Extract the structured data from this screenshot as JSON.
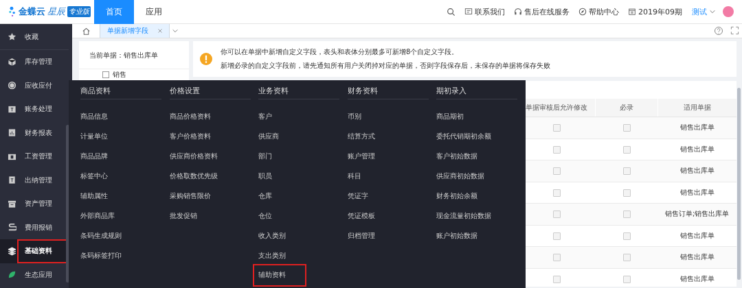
{
  "topbar": {
    "logo": {
      "brand": "金蝶云",
      "product": "星辰",
      "edition": "专业版"
    },
    "nav": [
      {
        "label": "首页",
        "selected": true
      },
      {
        "label": "应用",
        "selected": false
      }
    ],
    "links": [
      {
        "kind": "chat",
        "label": "联系我们"
      },
      {
        "kind": "headset",
        "label": "售后在线服务"
      },
      {
        "kind": "compass",
        "label": "帮助中心"
      },
      {
        "kind": "calendar",
        "label": "2019年09期"
      }
    ],
    "user": "测试"
  },
  "sidebar": {
    "items": [
      {
        "label": "收藏",
        "selected": false,
        "highlighted": false
      },
      {
        "label": "库存管理",
        "selected": false,
        "highlighted": false
      },
      {
        "label": "应收应付",
        "selected": false,
        "highlighted": false
      },
      {
        "label": "账务处理",
        "selected": false,
        "highlighted": false
      },
      {
        "label": "财务报表",
        "selected": false,
        "highlighted": false
      },
      {
        "label": "工资管理",
        "selected": false,
        "highlighted": false
      },
      {
        "label": "出纳管理",
        "selected": false,
        "highlighted": false
      },
      {
        "label": "资产管理",
        "selected": false,
        "highlighted": false
      },
      {
        "label": "费用报销",
        "selected": false,
        "highlighted": false
      },
      {
        "label": "基础资料",
        "selected": true,
        "highlighted": true
      },
      {
        "label": "生态应用",
        "selected": false,
        "highlighted": false
      }
    ]
  },
  "tabs": [
    {
      "label": "单据新增字段",
      "selected": true
    }
  ],
  "current_doc": {
    "label": "当前单据：销售出库单",
    "tree_item": "销售"
  },
  "notice": [
    "你可以在单据中新增自定义字段，表头和表体分别最多可新增8个自定义字段。",
    "新增必录的自定义字段前，请先通知所有用户关闭掉对应的单据，否则字段保存后，未保存的单据将保存失败"
  ],
  "table": {
    "columns": [
      "单据审核后允许修改",
      "必录",
      "适用单据"
    ],
    "rows": [
      {
        "allow_edit": false,
        "required": false,
        "doc": "销售出库单"
      },
      {
        "allow_edit": false,
        "required": false,
        "doc": "销售出库单"
      },
      {
        "allow_edit": false,
        "required": false,
        "doc": "销售出库单"
      },
      {
        "allow_edit": false,
        "required": false,
        "doc": "销售出库单"
      },
      {
        "allow_edit": false,
        "required": false,
        "doc": "销售订单;销售出库单"
      },
      {
        "allow_edit": false,
        "required": false,
        "doc": "销售出库单"
      },
      {
        "allow_edit": false,
        "required": false,
        "doc": "销售出库单"
      },
      {
        "allow_edit": false,
        "required": false,
        "doc": "销售出库单"
      }
    ]
  },
  "menu": {
    "columns": [
      {
        "title": "商品资料",
        "items": [
          {
            "label": "商品信息",
            "highlighted": false
          },
          {
            "label": "计量单位",
            "highlighted": false
          },
          {
            "label": "商品品牌",
            "highlighted": false
          },
          {
            "label": "标签中心",
            "highlighted": false
          },
          {
            "label": "辅助属性",
            "highlighted": false
          },
          {
            "label": "外部商品库",
            "highlighted": false
          },
          {
            "label": "条码生成规则",
            "highlighted": false
          },
          {
            "label": "条码标签打印",
            "highlighted": false
          }
        ]
      },
      {
        "title": "价格设置",
        "items": [
          {
            "label": "商品价格资料",
            "highlighted": false
          },
          {
            "label": "客户价格资料",
            "highlighted": false
          },
          {
            "label": "供应商价格资料",
            "highlighted": false
          },
          {
            "label": "价格取数优先级",
            "highlighted": false
          },
          {
            "label": "采购销售限价",
            "highlighted": false
          },
          {
            "label": "批发促销",
            "highlighted": false
          }
        ]
      },
      {
        "title": "业务资料",
        "items": [
          {
            "label": "客户",
            "highlighted": false
          },
          {
            "label": "供应商",
            "highlighted": false
          },
          {
            "label": "部门",
            "highlighted": false
          },
          {
            "label": "职员",
            "highlighted": false
          },
          {
            "label": "仓库",
            "highlighted": false
          },
          {
            "label": "仓位",
            "highlighted": false
          },
          {
            "label": "收入类别",
            "highlighted": false
          },
          {
            "label": "支出类别",
            "highlighted": false
          },
          {
            "label": "辅助资料",
            "highlighted": true
          }
        ]
      },
      {
        "title": "财务资料",
        "items": [
          {
            "label": "币别",
            "highlighted": false
          },
          {
            "label": "结算方式",
            "highlighted": false
          },
          {
            "label": "账户管理",
            "highlighted": false
          },
          {
            "label": "科目",
            "highlighted": false
          },
          {
            "label": "凭证字",
            "highlighted": false
          },
          {
            "label": "凭证模板",
            "highlighted": false
          },
          {
            "label": "归档管理",
            "highlighted": false
          }
        ]
      },
      {
        "title": "期初录入",
        "items": [
          {
            "label": "商品期初",
            "highlighted": false
          },
          {
            "label": "委托代销期初余额",
            "highlighted": false
          },
          {
            "label": "客户初始数据",
            "highlighted": false
          },
          {
            "label": "供应商初始数据",
            "highlighted": false
          },
          {
            "label": "财务初始余额",
            "highlighted": false
          },
          {
            "label": "现金流量初始数据",
            "highlighted": false
          },
          {
            "label": "账户初始数据",
            "highlighted": false
          }
        ]
      }
    ]
  }
}
